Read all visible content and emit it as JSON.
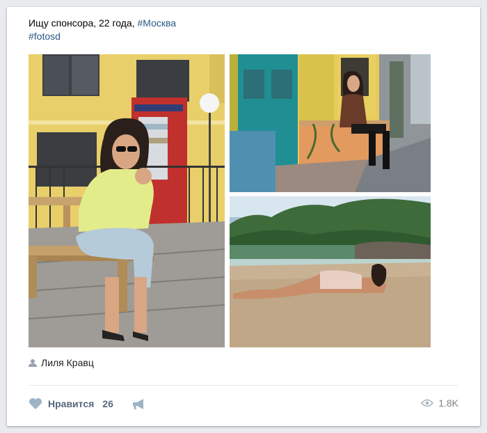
{
  "post": {
    "text_line1": "Ищу спонсора, 22 года, ",
    "hashtag1": "#Москва",
    "hashtag2": "#fotosd"
  },
  "photos": [
    {
      "name": "photo-woman-on-bench",
      "subject": "woman sitting on bench with sunglasses"
    },
    {
      "name": "photo-woman-on-street",
      "subject": "woman sitting by teal doors on street"
    },
    {
      "name": "photo-woman-on-beach",
      "subject": "woman lying on sandy beach"
    }
  ],
  "author": {
    "name": "Лиля Кравц",
    "icon": "person-icon"
  },
  "actions": {
    "like_label": "Нравится",
    "like_count": "26",
    "like_icon": "heart-icon",
    "share_icon": "megaphone-icon",
    "views": "1.8K",
    "views_icon": "eye-icon"
  },
  "colors": {
    "link": "#2a5885",
    "action_text": "#55677d",
    "muted": "#828282",
    "background": "#e9ebee"
  }
}
